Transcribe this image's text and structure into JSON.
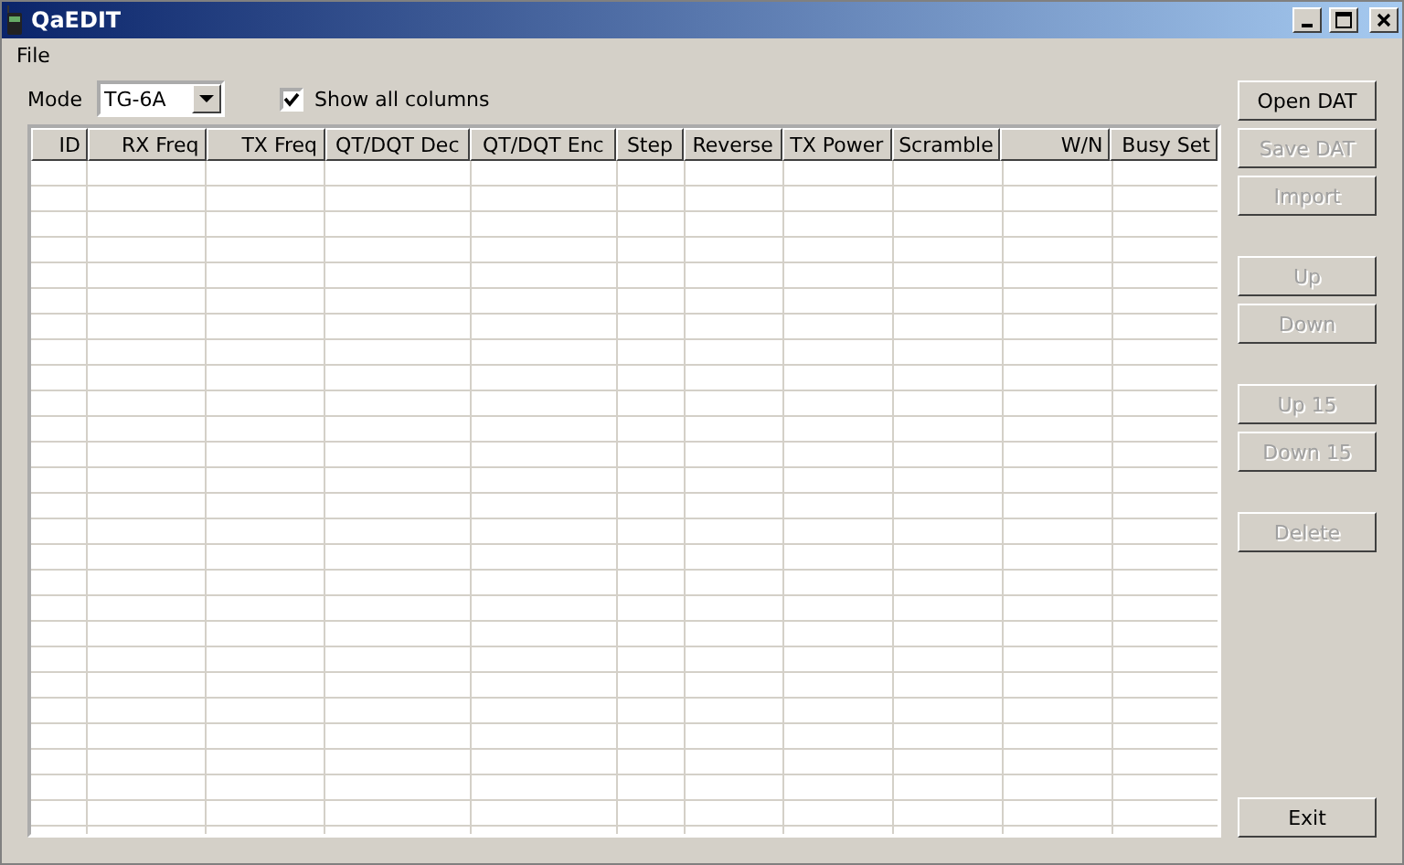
{
  "window": {
    "title": "QaEDIT"
  },
  "menu": [
    "File"
  ],
  "mode": {
    "label": "Mode",
    "value": "TG-6A"
  },
  "show_all_columns": {
    "label": "Show all columns",
    "checked": true
  },
  "table": {
    "columns": [
      "ID",
      "RX Freq",
      "TX Freq",
      "QT/DQT Dec",
      "QT/DQT Enc",
      "Step",
      "Reverse",
      "TX Power",
      "Scramble",
      "W/N",
      "Busy Set"
    ]
  },
  "button_groups": [
    [
      {
        "label": "Open DAT",
        "disabled": false
      },
      {
        "label": "Save DAT",
        "disabled": true
      },
      {
        "label": "Import",
        "disabled": true
      }
    ],
    [
      {
        "label": "Up",
        "disabled": true
      },
      {
        "label": "Down",
        "disabled": true
      }
    ],
    [
      {
        "label": "Up 15",
        "disabled": true
      },
      {
        "label": "Down 15",
        "disabled": true
      }
    ],
    [
      {
        "label": "Delete",
        "disabled": true
      }
    ]
  ],
  "exit_button": {
    "label": "Exit",
    "disabled": false
  }
}
